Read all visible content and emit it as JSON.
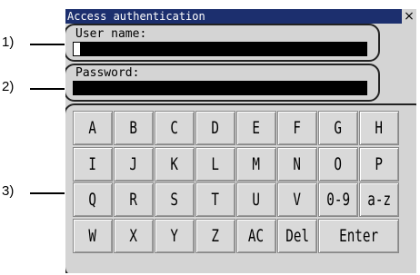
{
  "callouts": [
    "1)",
    "2)",
    "3)"
  ],
  "window": {
    "title": "Access authentication",
    "close_glyph": "×"
  },
  "username": {
    "label": "User name:",
    "value": ""
  },
  "password": {
    "label": "Password:",
    "value": ""
  },
  "keyboard": {
    "rows": [
      [
        "A",
        "B",
        "C",
        "D",
        "E",
        "F",
        "G",
        "H"
      ],
      [
        "I",
        "J",
        "K",
        "L",
        "M",
        "N",
        "O",
        "P"
      ],
      [
        "Q",
        "R",
        "S",
        "T",
        "U",
        "V",
        "0-9",
        "a-z"
      ],
      [
        "W",
        "X",
        "Y",
        "Z",
        "AC",
        "Del",
        "Enter"
      ]
    ]
  },
  "colors": {
    "titlebar": "#1c2f6e",
    "window_bg": "#d4d4d4",
    "field_bg": "#000000",
    "key_bg": "#d9d9d9"
  }
}
